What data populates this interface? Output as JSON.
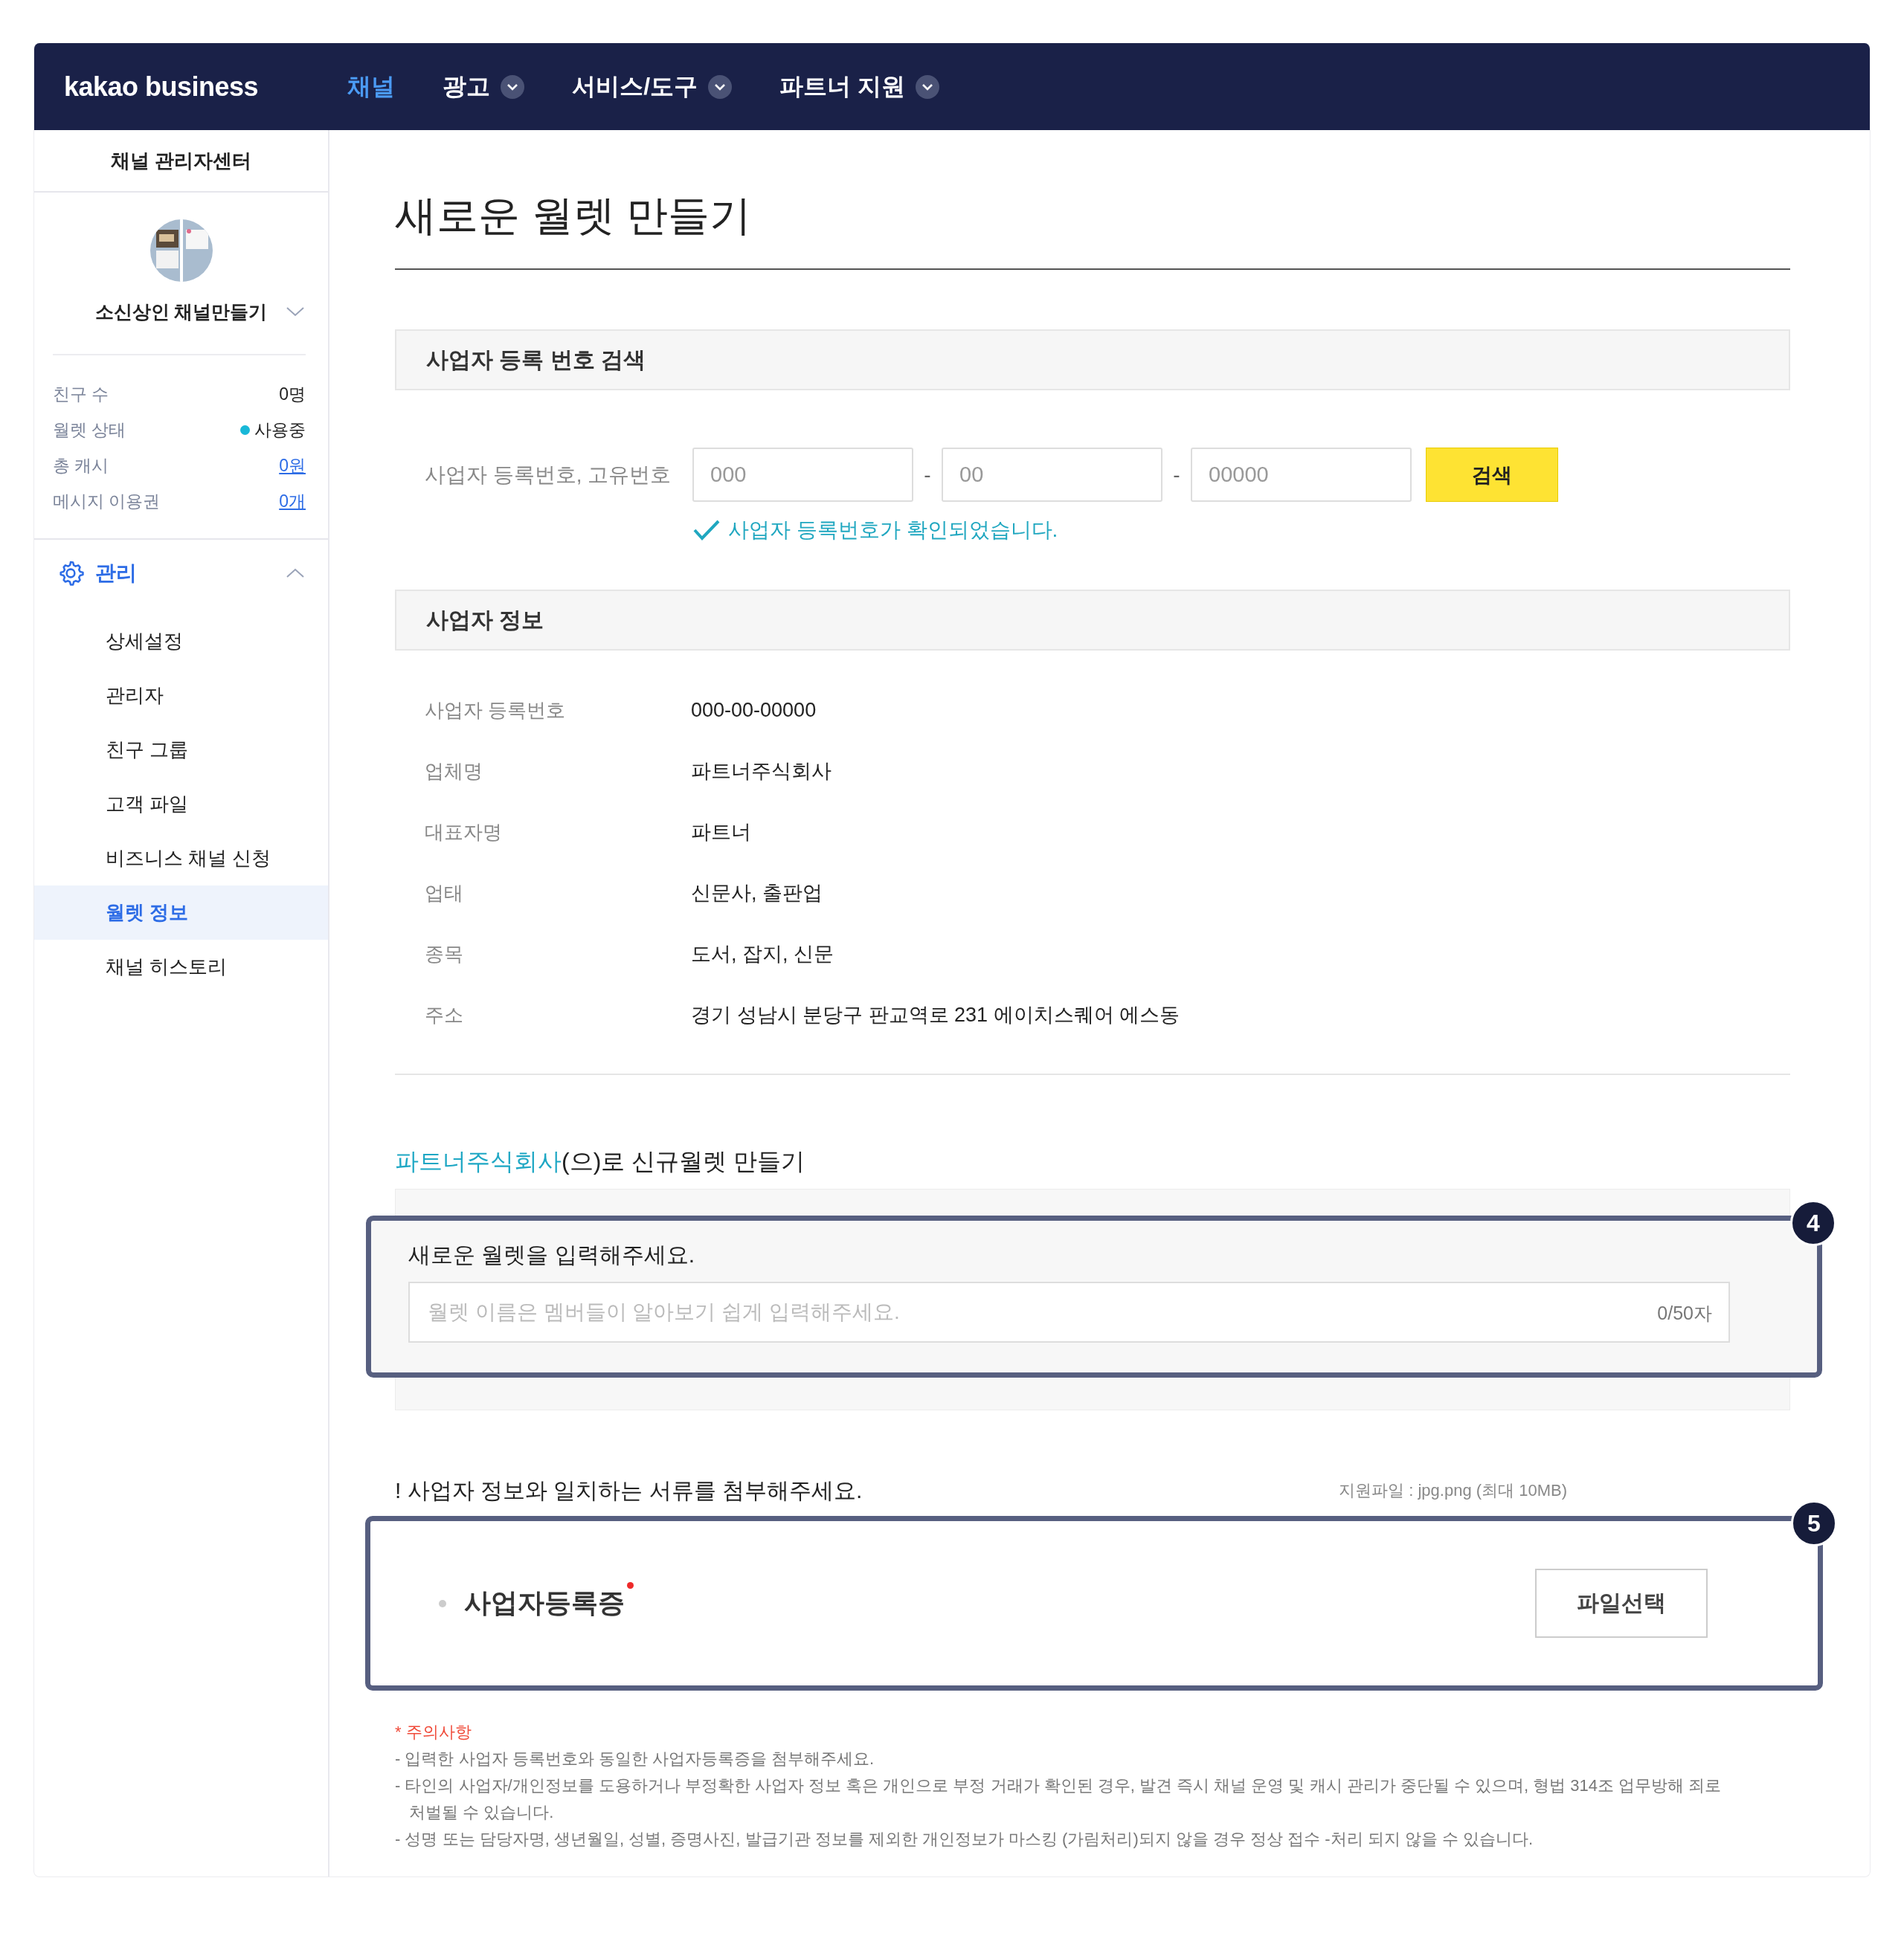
{
  "header": {
    "logo": "kakao business",
    "nav": [
      {
        "label": "채널",
        "selected": true,
        "dropdown": false
      },
      {
        "label": "광고",
        "selected": false,
        "dropdown": true
      },
      {
        "label": "서비스/도구",
        "selected": false,
        "dropdown": true
      },
      {
        "label": "파트너 지원",
        "selected": false,
        "dropdown": true
      }
    ]
  },
  "sidebar": {
    "title": "채널 관리자센터",
    "channel": "소신상인 채널만들기",
    "stats": [
      {
        "label": "친구 수",
        "value": "0명",
        "kind": "plain"
      },
      {
        "label": "월렛 상태",
        "value": "사용중",
        "kind": "status",
        "color": "#18b8d8"
      },
      {
        "label": "총 캐시",
        "value": "0원",
        "kind": "link"
      },
      {
        "label": "메시지 이용권",
        "value": "0개",
        "kind": "link"
      }
    ],
    "menu": {
      "label": "관리",
      "expanded": true,
      "items": [
        {
          "label": "상세설정",
          "selected": false
        },
        {
          "label": "관리자",
          "selected": false
        },
        {
          "label": "친구 그룹",
          "selected": false
        },
        {
          "label": "고객 파일",
          "selected": false
        },
        {
          "label": "비즈니스 채널 신청",
          "selected": false
        },
        {
          "label": "월렛 정보",
          "selected": true
        },
        {
          "label": "채널 히스토리",
          "selected": false
        }
      ]
    }
  },
  "page": {
    "title": "새로운 월렛 만들기"
  },
  "search_section": {
    "heading": "사업자 등록 번호 검색",
    "label": "사업자 등록번호, 고유번호",
    "fields": [
      {
        "placeholder": "000"
      },
      {
        "placeholder": "00"
      },
      {
        "placeholder": "00000"
      }
    ],
    "separators": [
      "-",
      "-"
    ],
    "button": "검색",
    "message": "사업자 등록번호가 확인되었습니다."
  },
  "info_section": {
    "heading": "사업자 정보",
    "rows": [
      {
        "label": "사업자 등록번호",
        "value": "000-00-00000"
      },
      {
        "label": "업체명",
        "value": "파트너주식회사"
      },
      {
        "label": "대표자명",
        "value": "파트너"
      },
      {
        "label": "업태",
        "value": "신문사, 출판업"
      },
      {
        "label": "종목",
        "value": "도서, 잡지, 신문"
      },
      {
        "label": "주소",
        "value": "경기 성남시 분당구 판교역로 231 에이치스퀘어 에스동"
      }
    ]
  },
  "wallet": {
    "company": "파트너주식회사",
    "intro": "(으)로 신규월렛 만들기",
    "callout": "4",
    "label": "새로운 월렛을 입력해주세요.",
    "placeholder": "월렛 이름은 멤버들이 알아보기 쉽게 입력해주세요.",
    "counter": "0/50자"
  },
  "documents": {
    "notice": "! 사업자 정보와 일치하는 서류를 첨부해주세요.",
    "file_types": "지원파일 : jpg.png (최대 10MB)",
    "callout": "5",
    "items": [
      {
        "label": "사업자등록증",
        "required": true,
        "button": "파일선택"
      }
    ]
  },
  "notes": {
    "title": "* 주의사항",
    "lines": [
      "- 입력한 사업자 등록번호와 동일한 사업자등록증을 첨부해주세요.",
      "- 타인의 사업자/개인정보를 도용하거나 부정확한 사업자 정보 혹은 개인으로 부정 거래가 확인된 경우, 발견 즉시 채널 운영 및 캐시 관리가 중단될 수 있으며, 형법 314조 업무방해 죄로 처벌될 수 있습니다.",
      "- 성명 또는 담당자명, 생년월일, 성별, 증명사진, 발급기관 정보를 제외한 개인정보가 마스킹 (가림처리)되지 않을 경우 정상 접수 -처리 되지 않을 수 있습니다."
    ]
  }
}
